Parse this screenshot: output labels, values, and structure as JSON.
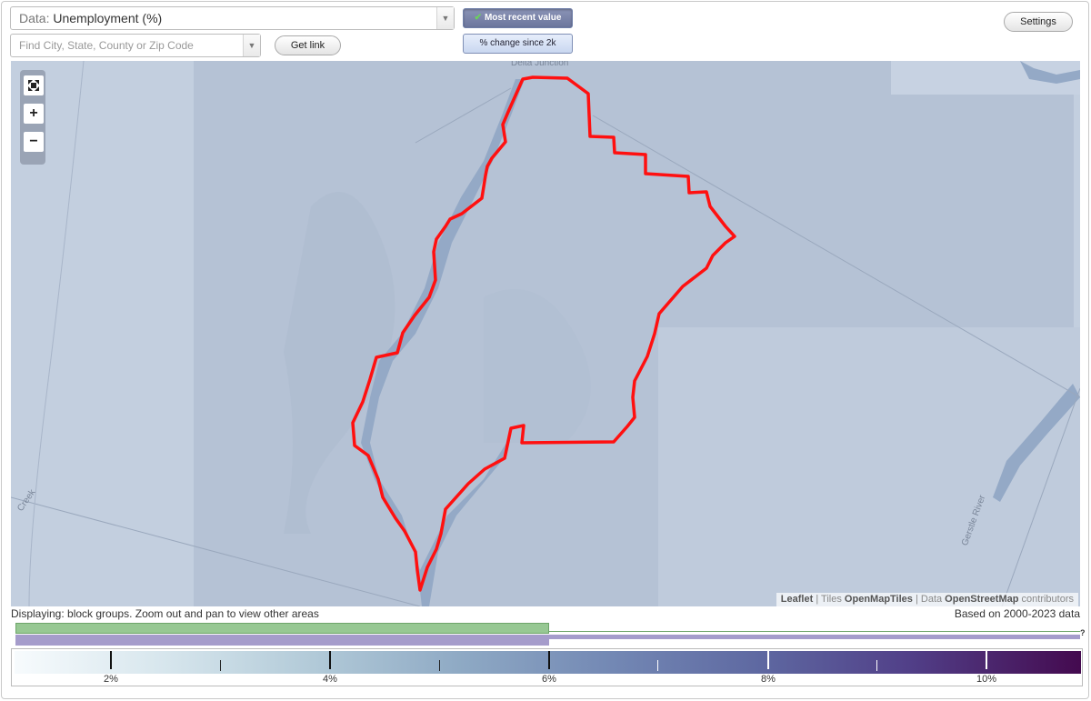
{
  "controls": {
    "data_prefix": "Data:",
    "data_value": "Unemployment (%)",
    "search_placeholder": "Find City, State, County or Zip Code",
    "get_link_label": "Get link",
    "toggle_active_label": "Most recent value",
    "toggle_inactive_label": "% change since 2k",
    "settings_label": "Settings"
  },
  "map": {
    "place_label": "Delta Junction",
    "creek_label": "Creek",
    "river_label": "Gerstle River",
    "zoom_full_icon": "fullscreen-icon",
    "zoom_in_symbol": "+",
    "zoom_out_symbol": "−",
    "attribution": {
      "leaflet": "Leaflet",
      "sep1": " | Tiles ",
      "tiles": "OpenMapTiles",
      "sep2": " | Data ",
      "osm": "OpenStreetMap",
      "suffix": " contributors"
    },
    "boundary_color": "#ff0000"
  },
  "status": {
    "displaying": "Displaying: block groups. Zoom out and pan to view other areas",
    "based_on": "Based on 2000-2023 data",
    "unknown_mark": "?"
  },
  "legend": {
    "ticks": [
      "2%",
      "4%",
      "6%",
      "8%",
      "10%"
    ]
  }
}
